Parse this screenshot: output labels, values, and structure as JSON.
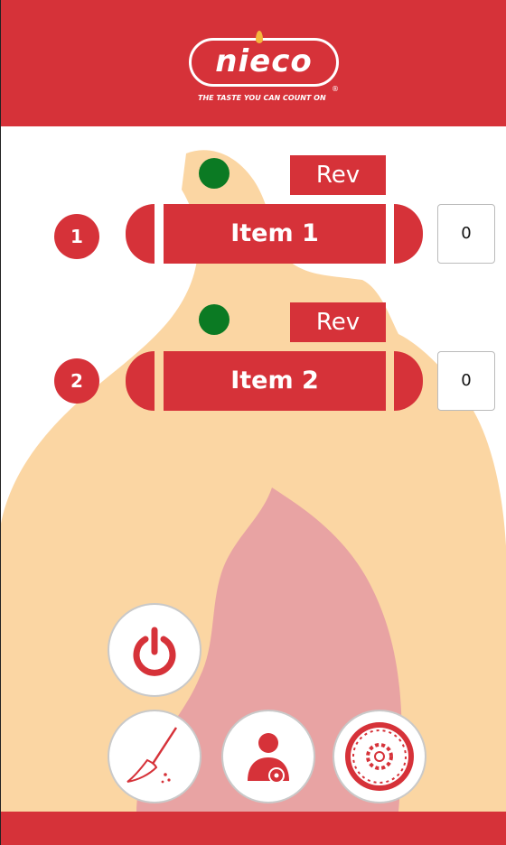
{
  "brand": {
    "logo_text": "nieco",
    "tagline": "THE TASTE YOU CAN COUNT ON",
    "registered_mark": "®"
  },
  "colors": {
    "primary_red": "#d63239",
    "status_green": "#0b7a23",
    "flame_outer": "#fbd6a3",
    "flame_inner": "#e8a3a3"
  },
  "rows": [
    {
      "number": "1",
      "label": "Item 1",
      "rev_label": "Rev",
      "count": "0",
      "status": "green"
    },
    {
      "number": "2",
      "label": "Item 2",
      "rev_label": "Rev",
      "count": "0",
      "status": "green"
    }
  ],
  "buttons": {
    "power": "power-icon",
    "clean": "broom-icon",
    "user_settings": "user-gear-icon",
    "system_settings": "dial-gear-icon"
  }
}
